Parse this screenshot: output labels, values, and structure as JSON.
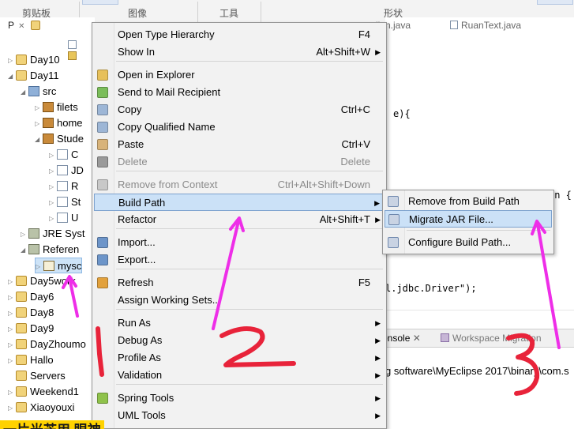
{
  "ribbon": {
    "groups": [
      "剪贴板",
      "图像",
      "工具",
      "形状"
    ]
  },
  "explorer": {
    "tab_label": "P",
    "tree": [
      {
        "label": "Day10",
        "icon": "project-icon"
      },
      {
        "label": "Day11",
        "icon": "project-icon"
      },
      {
        "label": "src",
        "icon": "source-folder-icon"
      },
      {
        "label": "filets",
        "icon": "package-icon"
      },
      {
        "label": "home",
        "icon": "package-icon"
      },
      {
        "label": "Stude",
        "icon": "package-icon"
      },
      {
        "label": "C",
        "icon": "java-file-icon"
      },
      {
        "label": "JD",
        "icon": "java-file-icon"
      },
      {
        "label": "R",
        "icon": "java-file-icon"
      },
      {
        "label": "St",
        "icon": "java-file-icon"
      },
      {
        "label": "U",
        "icon": "java-file-icon"
      },
      {
        "label": "JRE Syst",
        "icon": "library-icon"
      },
      {
        "label": "Referen",
        "icon": "library-icon"
      },
      {
        "label": "mysc",
        "icon": "jar-icon"
      },
      {
        "label": "Day5work",
        "icon": "project-icon"
      },
      {
        "label": "Day6",
        "icon": "project-icon"
      },
      {
        "label": "Day8",
        "icon": "project-icon"
      },
      {
        "label": "Day9",
        "icon": "project-icon"
      },
      {
        "label": "DayZhoumo",
        "icon": "project-icon"
      },
      {
        "label": "Hallo",
        "icon": "project-icon"
      },
      {
        "label": "Servers",
        "icon": "project-icon"
      },
      {
        "label": "Weekend1",
        "icon": "project-icon"
      },
      {
        "label": "Xiaoyouxi",
        "icon": "project-icon"
      }
    ]
  },
  "editor": {
    "tabs": [
      "lian.java",
      "RuanText.java"
    ],
    "code_lines": [
      "e){",
      "on {",
      "l.jdbc.Driver\");"
    ]
  },
  "console": {
    "tabs": [
      "onsole",
      "Workspace Migration"
    ],
    "output": "g software\\MyEclipse 2017\\binary\\com.s"
  },
  "context_menu": {
    "items": [
      {
        "label": "Open Type Hierarchy",
        "shortcut": "F4",
        "submenu": false,
        "disabled": false
      },
      {
        "label": "Show In",
        "shortcut": "Alt+Shift+W",
        "submenu": true,
        "disabled": false
      },
      {
        "label": "Open in Explorer",
        "shortcut": "",
        "submenu": false,
        "disabled": false
      },
      {
        "label": "Send to Mail Recipient",
        "shortcut": "",
        "submenu": false,
        "disabled": false
      },
      {
        "label": "Copy",
        "shortcut": "Ctrl+C",
        "submenu": false,
        "disabled": false
      },
      {
        "label": "Copy Qualified Name",
        "shortcut": "",
        "submenu": false,
        "disabled": false
      },
      {
        "label": "Paste",
        "shortcut": "Ctrl+V",
        "submenu": false,
        "disabled": false
      },
      {
        "label": "Delete",
        "shortcut": "Delete",
        "submenu": false,
        "disabled": true
      },
      {
        "label": "Remove from Context",
        "shortcut": "Ctrl+Alt+Shift+Down",
        "submenu": false,
        "disabled": true
      },
      {
        "label": "Build Path",
        "shortcut": "",
        "submenu": true,
        "disabled": false
      },
      {
        "label": "Refactor",
        "shortcut": "Alt+Shift+T",
        "submenu": true,
        "disabled": false
      },
      {
        "label": "Import...",
        "shortcut": "",
        "submenu": false,
        "disabled": false
      },
      {
        "label": "Export...",
        "shortcut": "",
        "submenu": false,
        "disabled": false
      },
      {
        "label": "Refresh",
        "shortcut": "F5",
        "submenu": false,
        "disabled": false
      },
      {
        "label": "Assign Working Sets...",
        "shortcut": "",
        "submenu": false,
        "disabled": false
      },
      {
        "label": "Run As",
        "shortcut": "",
        "submenu": true,
        "disabled": false
      },
      {
        "label": "Debug As",
        "shortcut": "",
        "submenu": true,
        "disabled": false
      },
      {
        "label": "Profile As",
        "shortcut": "",
        "submenu": true,
        "disabled": false
      },
      {
        "label": "Validation",
        "shortcut": "",
        "submenu": true,
        "disabled": false
      },
      {
        "label": "Spring Tools",
        "shortcut": "",
        "submenu": true,
        "disabled": false
      },
      {
        "label": "UML Tools",
        "shortcut": "",
        "submenu": true,
        "disabled": false
      }
    ]
  },
  "submenu": {
    "items": [
      {
        "label": "Remove from Build Path"
      },
      {
        "label": "Migrate JAR File..."
      },
      {
        "label": "Configure Build Path..."
      }
    ]
  },
  "annotations": {
    "numbers": [
      "1",
      "2",
      "3"
    ],
    "color": "#e8233a",
    "arrow_color": "#ee2ee8"
  },
  "banner": {
    "text": "一片光芒用 眼神"
  }
}
